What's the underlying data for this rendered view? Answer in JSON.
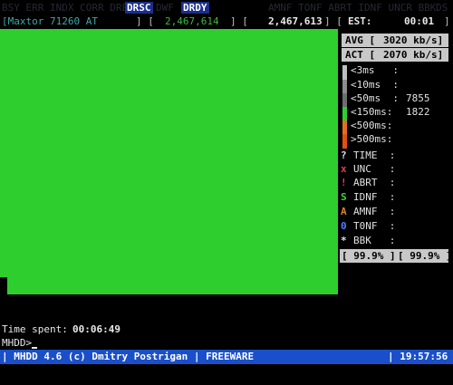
{
  "flags_top": {
    "dim_left": "BSY ERR INDX CORR DREQ",
    "drsc": "DRSC",
    "dim_mid": "DWF",
    "drdy": "DRDY",
    "dim_right": "AMNF TONF ABRT IDNF UNCR BBK ",
    "dim_end": "DS"
  },
  "header": {
    "drive": "[Maxtor 71260 AT",
    "bracket_close": "] [",
    "lba_current": "2,467,614",
    "bracket_mid": "] [",
    "lba_total": "2,467,613",
    "bracket_end": "] [",
    "est_label": "EST:",
    "est_value": "00:01",
    "est_close": "]"
  },
  "speed": {
    "avg_label": "AVG [",
    "avg_value": "3020 kb/s]",
    "act_label": "ACT [",
    "act_value": "2070 kb/s]"
  },
  "latency": [
    {
      "label": "<3ms   :",
      "count": "",
      "color": "#bfbfbf"
    },
    {
      "label": "<10ms  :",
      "count": "",
      "color": "#8c8c8c"
    },
    {
      "label": "<50ms  :",
      "count": "7855",
      "color": "#6e6e6e"
    },
    {
      "label": "<150ms:",
      "count": "1822",
      "color": "#2fce2f"
    },
    {
      "label": "<500ms:",
      "count": "",
      "color": "#e07020"
    },
    {
      "label": ">500ms:",
      "count": "",
      "color": "#e05010"
    }
  ],
  "errors": [
    {
      "symbol": "?",
      "label": "TIME  :",
      "color": "#e0e0e0"
    },
    {
      "symbol": "x",
      "label": "UNC   :",
      "color": "#e04040"
    },
    {
      "symbol": "!",
      "label": "ABRT  :",
      "color": "#e04040"
    },
    {
      "symbol": "S",
      "label": "IDNF  :",
      "color": "#3fd63f"
    },
    {
      "symbol": "A",
      "label": "AMNF  :",
      "color": "#e08030"
    },
    {
      "symbol": "0",
      "label": "T0NF  :",
      "color": "#4f7fff"
    },
    {
      "symbol": "*",
      "label": "BBK   :",
      "color": "#e0e0e0"
    }
  ],
  "progress": {
    "left": "[ 99.9% ]",
    "right": "[ 99.9% ]"
  },
  "footer": {
    "time_spent_label": "Time spent:",
    "time_spent_value": "00:06:49",
    "prompt": "MHDD>",
    "title": "| MHDD 4.6 (c) Dmitry Postrigan | FREEWARE",
    "clock": "| 19:57:56"
  }
}
